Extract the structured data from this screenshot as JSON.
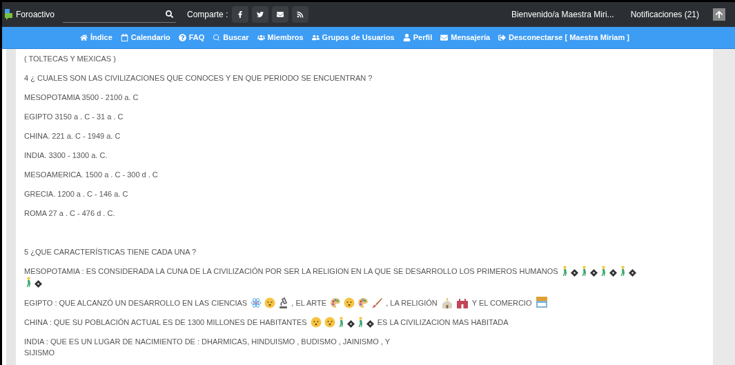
{
  "topbar": {
    "brand": "Foroactivo",
    "share_label": "Comparte :",
    "welcome": "Bienvenido/a Maestra Miri...",
    "notifications": "Notificaciones (21)"
  },
  "nav": [
    {
      "label": "Índice"
    },
    {
      "label": "Calendario"
    },
    {
      "label": "FAQ"
    },
    {
      "label": "Buscar"
    },
    {
      "label": "Miembros"
    },
    {
      "label": "Grupos de Usuarios"
    },
    {
      "label": "Perfil"
    },
    {
      "label": "Mensajería"
    },
    {
      "label": "Desconectarse [ Maestra Miriam ]"
    }
  ],
  "post": [
    {
      "segments": [
        {
          "kind": "text",
          "text": "( TOLTECAS Y MEXICAS )"
        }
      ]
    },
    {
      "segments": [
        {
          "kind": "text",
          "text": "4 ¿ CUALES SON LAS CIVILIZACIONES QUE CONOCES Y EN QUE PERIODO SE ENCUENTRAN ?"
        }
      ]
    },
    {
      "segments": [
        {
          "kind": "text",
          "text": "MESOPOTAMIA 3500 - 2100 a. C"
        }
      ]
    },
    {
      "segments": [
        {
          "kind": "text",
          "text": "EGIPTO 3150 a . C - 31 a . C"
        }
      ]
    },
    {
      "segments": [
        {
          "kind": "text",
          "text": "CHINA. 221 a. C - 1949 a. C"
        }
      ]
    },
    {
      "segments": [
        {
          "kind": "text",
          "text": "INDIA. 3300 - 1300 a. C."
        }
      ]
    },
    {
      "segments": [
        {
          "kind": "text",
          "text": "MESOAMERICA. 1500 a . C - 300 d . C"
        }
      ]
    },
    {
      "segments": [
        {
          "kind": "text",
          "text": "GRECIA. 1200 a . C - 146 a. C"
        }
      ]
    },
    {
      "segments": [
        {
          "kind": "text",
          "text": "ROMA 27 a . C - 476 d . C."
        }
      ]
    },
    {
      "gap": true,
      "segments": [
        {
          "kind": "text",
          "text": "5 ¿QUE CARACTERÍSTICAS TIENE CADA UNA ?"
        }
      ]
    },
    {
      "segments": [
        {
          "kind": "text",
          "text": "MESOPOTAMIA : ES CONSIDERADA LA CUNA DE LA CIVILIZACIÓN POR SER LA RELIGION EN LA QUE SE DESARROLLO LOS PRIMEROS HUMANOS"
        },
        {
          "kind": "walker"
        },
        {
          "kind": "unknown"
        },
        {
          "kind": "walker"
        },
        {
          "kind": "unknown"
        },
        {
          "kind": "walker"
        },
        {
          "kind": "unknown"
        },
        {
          "kind": "walker"
        },
        {
          "kind": "unknown"
        },
        {
          "kind": "break"
        },
        {
          "kind": "walker"
        },
        {
          "kind": "unknown"
        }
      ]
    },
    {
      "segments": [
        {
          "kind": "text",
          "text": "EGIPTO : QUE ALCANZÓ UN DESARROLLO EN LAS CIENCIAS"
        },
        {
          "kind": "atom"
        },
        {
          "kind": "face"
        },
        {
          "kind": "microscope"
        },
        {
          "kind": "text",
          "text": ", EL ARTE"
        },
        {
          "kind": "palette"
        },
        {
          "kind": "face"
        },
        {
          "kind": "palette"
        },
        {
          "kind": "brush"
        },
        {
          "kind": "text",
          "text": ", LA RELIGIÓN"
        },
        {
          "kind": "church"
        },
        {
          "kind": "temple"
        },
        {
          "kind": "text",
          "text": "Y EL COMERCIO"
        },
        {
          "kind": "shop"
        }
      ]
    },
    {
      "segments": [
        {
          "kind": "text",
          "text": "CHINA : QUE SU POBLACIÓN ACTUAL ES DE 1300 MILLONES DE HABITANTES"
        },
        {
          "kind": "face"
        },
        {
          "kind": "face"
        },
        {
          "kind": "walker"
        },
        {
          "kind": "unknown"
        },
        {
          "kind": "walker"
        },
        {
          "kind": "unknown"
        },
        {
          "kind": "text",
          "text": "ES LA CIVILIZACION MAS HABITADA"
        }
      ]
    },
    {
      "segments": [
        {
          "kind": "text",
          "text": "INDIA : QUE ES UN LUGAR DE NACIMIENTO DE : DHARMICAS, HINDUISMO , BUDISMO , JAINISMO , Y"
        },
        {
          "kind": "break"
        },
        {
          "kind": "text",
          "text": "SIJISMO"
        }
      ]
    }
  ]
}
